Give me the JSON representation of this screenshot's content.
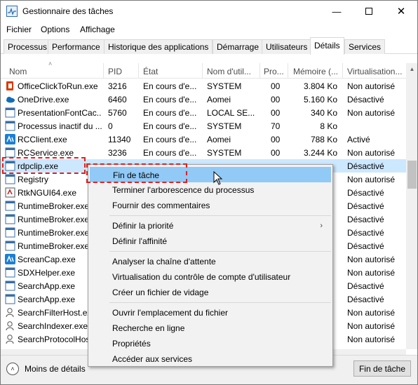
{
  "window": {
    "title": "Gestionnaire des tâches",
    "min_icon": "minimize-icon",
    "max_icon": "maximize-icon",
    "close_icon": "close-icon"
  },
  "menu": [
    "Fichier",
    "Options",
    "Affichage"
  ],
  "tabs": [
    {
      "label": "Processus",
      "active": false
    },
    {
      "label": "Performance",
      "active": false
    },
    {
      "label": "Historique des applications",
      "active": false
    },
    {
      "label": "Démarrage",
      "active": false
    },
    {
      "label": "Utilisateurs",
      "active": false
    },
    {
      "label": "Détails",
      "active": true
    },
    {
      "label": "Services",
      "active": false
    }
  ],
  "columns": {
    "name": "Nom",
    "pid": "PID",
    "status": "État",
    "user": "Nom d'util...",
    "cpu": "Pro...",
    "memory": "Mémoire (...",
    "virtualization": "Virtualisation..."
  },
  "rows": [
    {
      "icon": "office-icon",
      "name": "OfficeClickToRun.exe",
      "pid": "3216",
      "status": "En cours d'e...",
      "user": "SYSTEM",
      "cpu": "00",
      "memory": "3.804 Ko",
      "virt": "Non autorisé",
      "selected": false
    },
    {
      "icon": "onedrive-icon",
      "name": "OneDrive.exe",
      "pid": "6460",
      "status": "En cours d'e...",
      "user": "Aomei",
      "cpu": "00",
      "memory": "5.160 Ko",
      "virt": "Désactivé",
      "selected": false
    },
    {
      "icon": "app-window-icon",
      "name": "PresentationFontCac...",
      "pid": "5760",
      "status": "En cours d'e...",
      "user": "LOCAL SE...",
      "cpu": "00",
      "memory": "340 Ko",
      "virt": "Non autorisé",
      "selected": false
    },
    {
      "icon": "app-window-icon",
      "name": "Processus inactif du ...",
      "pid": "0",
      "status": "En cours d'e...",
      "user": "SYSTEM",
      "cpu": "70",
      "memory": "8 Ko",
      "virt": "",
      "selected": false
    },
    {
      "icon": "rcclient-icon",
      "name": "RCClient.exe",
      "pid": "11340",
      "status": "En cours d'e...",
      "user": "Aomei",
      "cpu": "00",
      "memory": "788 Ko",
      "virt": "Activé",
      "selected": false
    },
    {
      "icon": "app-window-icon",
      "name": "RCService.exe",
      "pid": "3236",
      "status": "En cours d'e...",
      "user": "SYSTEM",
      "cpu": "00",
      "memory": "3.244 Ko",
      "virt": "Non autorisé",
      "selected": false
    },
    {
      "icon": "app-window-icon",
      "name": "rdpclip.exe",
      "pid": "",
      "status": "",
      "user": "",
      "cpu": "",
      "memory": "",
      "virt": "Désactivé",
      "selected": true
    },
    {
      "icon": "app-window-icon",
      "name": "Registry",
      "pid": "",
      "status": "",
      "user": "",
      "cpu": "",
      "memory": "",
      "virt": "Non autorisé",
      "selected": false
    },
    {
      "icon": "rtk-icon",
      "name": "RtkNGUI64.exe",
      "pid": "",
      "status": "",
      "user": "",
      "cpu": "",
      "memory": "",
      "virt": "Désactivé",
      "selected": false
    },
    {
      "icon": "app-window-icon",
      "name": "RuntimeBroker.exe",
      "pid": "",
      "status": "",
      "user": "",
      "cpu": "",
      "memory": "",
      "virt": "Désactivé",
      "selected": false
    },
    {
      "icon": "app-window-icon",
      "name": "RuntimeBroker.exe",
      "pid": "",
      "status": "",
      "user": "",
      "cpu": "",
      "memory": "",
      "virt": "Désactivé",
      "selected": false
    },
    {
      "icon": "app-window-icon",
      "name": "RuntimeBroker.exe",
      "pid": "",
      "status": "",
      "user": "",
      "cpu": "",
      "memory": "",
      "virt": "Désactivé",
      "selected": false
    },
    {
      "icon": "app-window-icon",
      "name": "RuntimeBroker.exe",
      "pid": "",
      "status": "",
      "user": "",
      "cpu": "",
      "memory": "",
      "virt": "Désactivé",
      "selected": false
    },
    {
      "icon": "screencap-icon",
      "name": "ScreanCap.exe",
      "pid": "",
      "status": "",
      "user": "",
      "cpu": "",
      "memory": "",
      "virt": "Non autorisé",
      "selected": false
    },
    {
      "icon": "app-window-icon",
      "name": "SDXHelper.exe",
      "pid": "",
      "status": "",
      "user": "",
      "cpu": "",
      "memory": "",
      "virt": "Non autorisé",
      "selected": false
    },
    {
      "icon": "app-window-icon",
      "name": "SearchApp.exe",
      "pid": "",
      "status": "",
      "user": "",
      "cpu": "",
      "memory": "",
      "virt": "Désactivé",
      "selected": false
    },
    {
      "icon": "app-window-icon",
      "name": "SearchApp.exe",
      "pid": "",
      "status": "",
      "user": "",
      "cpu": "",
      "memory": "",
      "virt": "Désactivé",
      "selected": false
    },
    {
      "icon": "search-host-icon",
      "name": "SearchFilterHost.exe",
      "pid": "",
      "status": "",
      "user": "",
      "cpu": "",
      "memory": "",
      "virt": "Non autorisé",
      "selected": false
    },
    {
      "icon": "search-host-icon",
      "name": "SearchIndexer.exe",
      "pid": "",
      "status": "",
      "user": "",
      "cpu": "",
      "memory": "",
      "virt": "Non autorisé",
      "selected": false
    },
    {
      "icon": "search-host-icon",
      "name": "SearchProtocolHos...",
      "pid": "",
      "status": "",
      "user": "",
      "cpu": "",
      "memory": "",
      "virt": "Non autorisé",
      "selected": false
    }
  ],
  "context_menu": {
    "items": [
      {
        "label": "Fin de tâche",
        "hover": true
      },
      {
        "label": "Terminer l'arborescence du processus"
      },
      {
        "label": "Fournir des commentaires"
      },
      {
        "sep": true
      },
      {
        "label": "Définir la priorité",
        "submenu": true
      },
      {
        "label": "Définir l'affinité"
      },
      {
        "sep": true
      },
      {
        "label": "Analyser la chaîne d'attente"
      },
      {
        "label": "Virtualisation du contrôle de compte d'utilisateur"
      },
      {
        "label": "Créer un fichier de vidage"
      },
      {
        "sep": true
      },
      {
        "label": "Ouvrir l'emplacement du fichier"
      },
      {
        "label": "Recherche en ligne"
      },
      {
        "label": "Propriétés"
      },
      {
        "label": "Accéder aux services"
      }
    ]
  },
  "footer": {
    "less_details": "Moins de détails",
    "end_task": "Fin de tâche"
  },
  "colors": {
    "selected_row": "#cce8ff",
    "menu_hover": "#91c9f7",
    "highlight": "#e02020"
  }
}
